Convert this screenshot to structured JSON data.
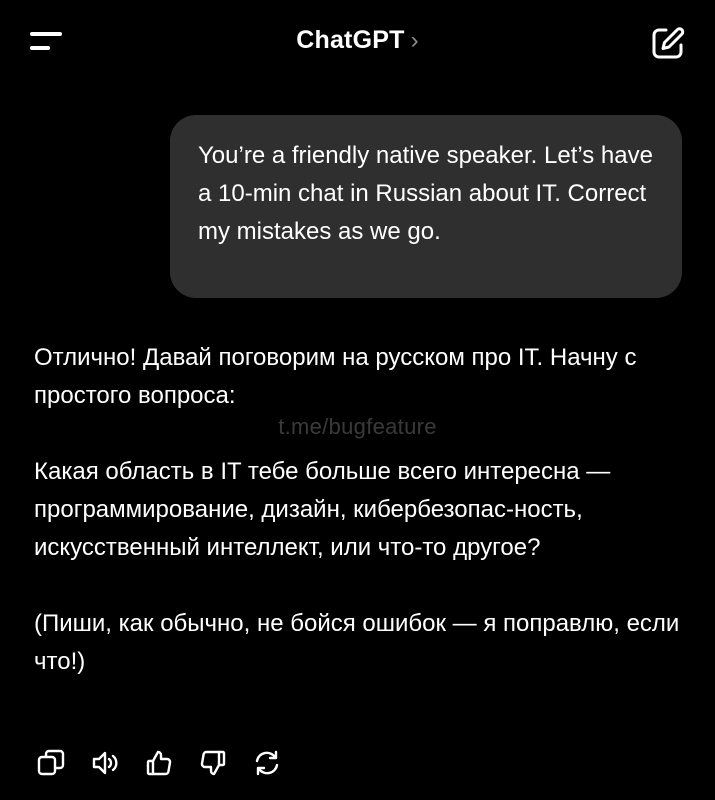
{
  "header": {
    "title": "ChatGPT",
    "title_chevron": "›",
    "menu_icon": "menu-icon",
    "edit_icon": "new-chat-icon"
  },
  "user_message": {
    "text": "You’re a friendly native speaker. Let’s have a 10-min chat in Russian about IT. Correct my mistakes as we go."
  },
  "assistant_message": {
    "paragraph1": "Отлично! Давай поговорим на русском про IT. Начну с простого вопроса:",
    "paragraph2": "Какая область в IT тебе больше всего интересна — программирование, дизайн, кибербезопас-ность, искусственный интеллект, или что-то другое?",
    "paragraph3": "(Пиши, как обычно, не бойся ошибок — я поправлю, если что!)"
  },
  "watermark": "t.me/bugfeature",
  "actions": [
    {
      "icon": "copy-icon"
    },
    {
      "icon": "speaker-icon"
    },
    {
      "icon": "thumbs-up-icon"
    },
    {
      "icon": "thumbs-down-icon"
    },
    {
      "icon": "regenerate-icon"
    }
  ],
  "colors": {
    "background": "#000000",
    "user_bubble": "#2f2f2f",
    "text": "#ffffff",
    "muted": "#8e8e93"
  }
}
